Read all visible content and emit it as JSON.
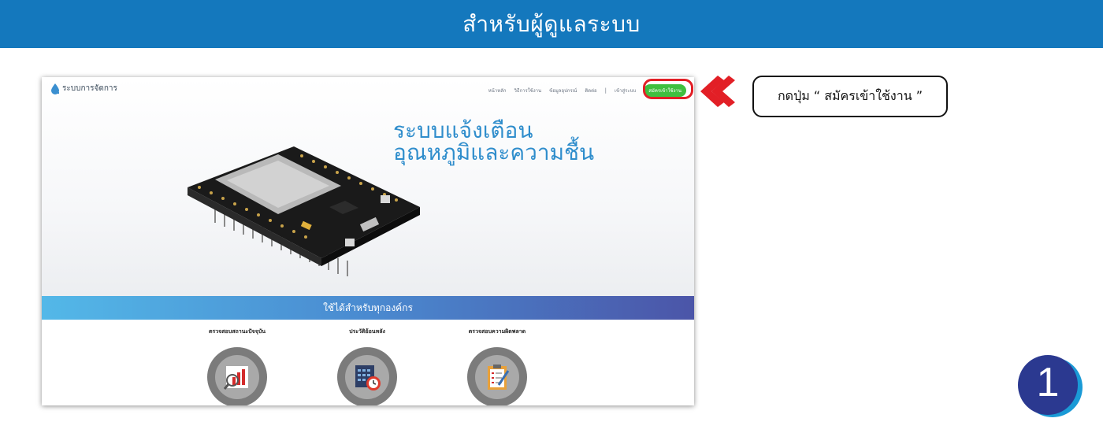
{
  "banner": {
    "title": "สำหรับผู้ดูแลระบบ"
  },
  "site": {
    "brand": "ระบบการจัดการ",
    "nav": [
      "หน้าหลัก",
      "วิธีการใช้งาน",
      "ข้อมูลอุปกรณ์",
      "ติดต่อ"
    ],
    "separator": "|",
    "login": "เข้าสู่ระบบ",
    "signup": "สมัครเข้าใช้งาน",
    "hero_line1": "ระบบแจ้งเตือน",
    "hero_line2": "อุณหภูมิและความชื้น",
    "band_text": "ใช้ได้สำหรับทุกองค์กร",
    "features": [
      {
        "label": "ตรวจสอบสถานะปัจจุบัน",
        "icon": "chart-magnifier-icon"
      },
      {
        "label": "ประวัติย้อนหลัง",
        "icon": "calendar-clock-icon"
      },
      {
        "label": "ตรวจสอบความผิดพลาด",
        "icon": "checklist-pencil-icon"
      }
    ]
  },
  "callout": {
    "text": "กดปุ่ม “ สมัครเข้าใช้งาน ”"
  },
  "step": {
    "number": "1"
  },
  "colors": {
    "banner": "#1478bd",
    "accent_red": "#e21f26",
    "signup_green": "#3fbf3f",
    "hero_blue": "#2f8dcc",
    "step_navy": "#2b3990"
  }
}
